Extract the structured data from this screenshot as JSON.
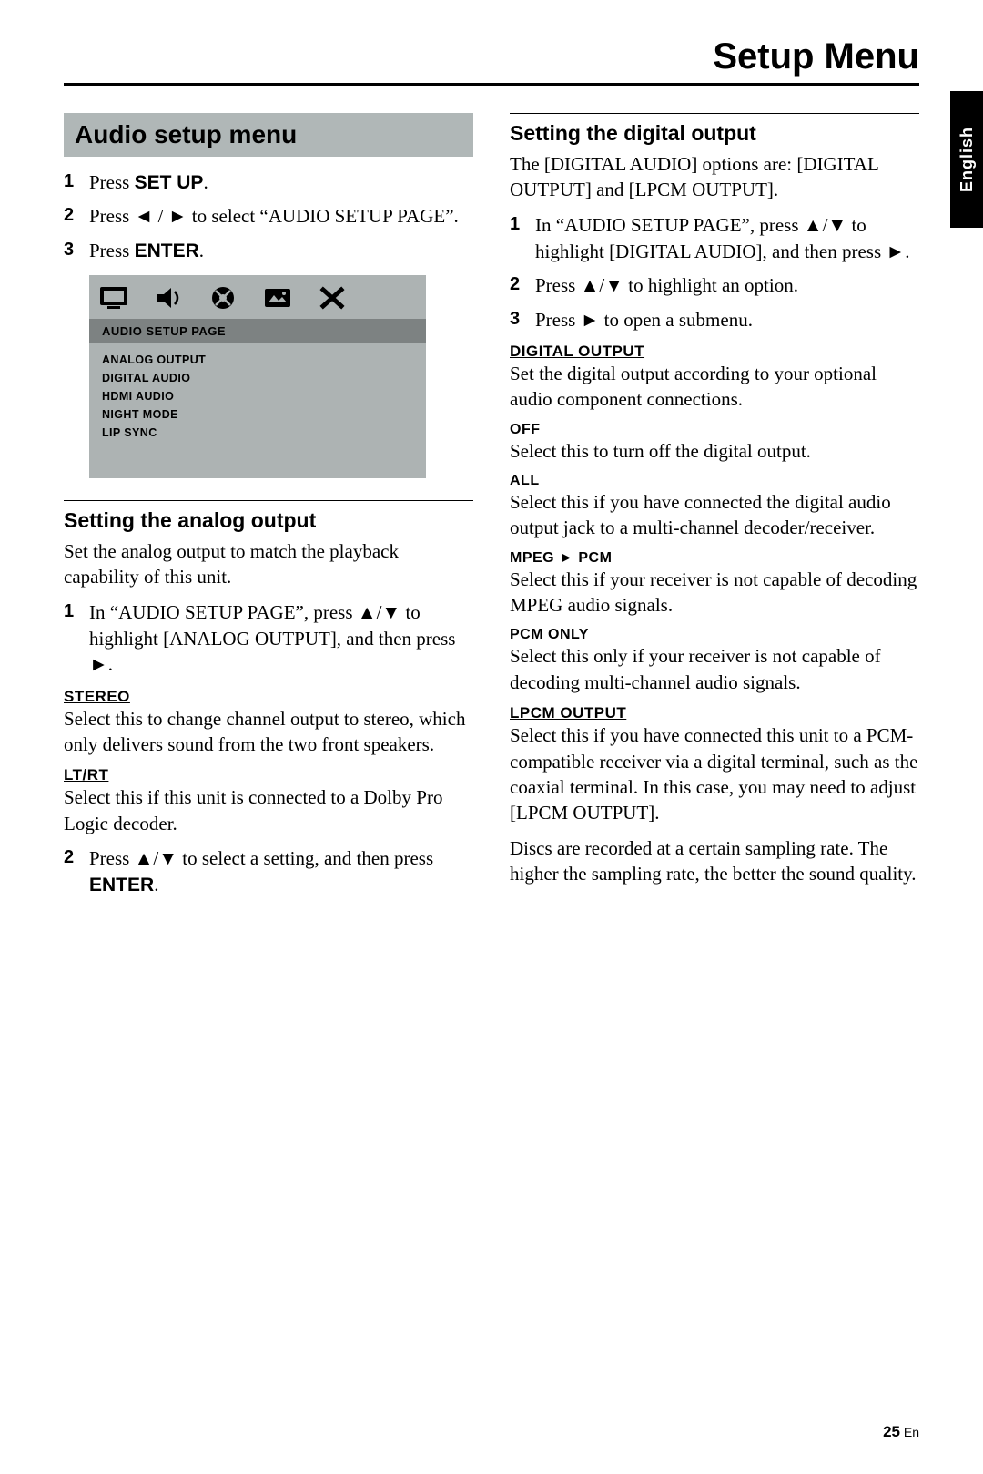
{
  "header": {
    "title": "Setup Menu"
  },
  "langTab": "English",
  "left": {
    "titleBar": "Audio setup menu",
    "steps1": {
      "s1_a": "Press ",
      "s1_b": "SET UP",
      "s1_c": ".",
      "s2_a": "Press ",
      "s2_arrL": "◄",
      "s2_slash": " / ",
      "s2_arrR": "►",
      "s2_b": " to select “AUDIO SETUP PAGE”.",
      "s3_a": "Press ",
      "s3_b": "ENTER",
      "s3_c": "."
    },
    "osd": {
      "banner": "AUDIO SETUP PAGE",
      "items": [
        "ANALOG OUTPUT",
        "DIGITAL AUDIO",
        "HDMI AUDIO",
        "NIGHT MODE",
        "LIP SYNC"
      ]
    },
    "analog": {
      "head": "Setting the analog output",
      "intro": "Set the analog output to match the playback capability of this unit.",
      "s1_a": "In “AUDIO SETUP PAGE”, press ",
      "s1_up": "▲",
      "s1_sl": "/",
      "s1_dn": "▼",
      "s1_b": " to highlight [ANALOG OUTPUT], and then press ",
      "s1_play": "►",
      "s1_c": ".",
      "stereo_h": "STEREO",
      "stereo_t": "Select this to change channel output to stereo, which only delivers sound from the two front speakers.",
      "ltrt_h": "LT/RT",
      "ltrt_t": "Select this if this unit is connected to a Dolby Pro Logic decoder.",
      "s2_a": "Press ",
      "s2_up": "▲",
      "s2_sl": "/",
      "s2_dn": "▼",
      "s2_b": " to select a setting, and then press ",
      "s2_enter": "ENTER",
      "s2_c": "."
    }
  },
  "right": {
    "digital": {
      "head": "Setting the digital output",
      "intro": "The [DIGITAL AUDIO] options are: [DIGITAL OUTPUT] and [LPCM OUTPUT].",
      "s1_a": "In “AUDIO SETUP PAGE”, press ",
      "s1_up": "▲",
      "s1_sl": "/",
      "s1_dn": "▼",
      "s1_b": " to highlight [DIGITAL AUDIO], and then press ",
      "s1_play": "►",
      "s1_c": ".",
      "s2_a": "Press ",
      "s2_up": "▲",
      "s2_sl": "/",
      "s2_dn": "▼",
      "s2_b": " to highlight an option.",
      "s3_a": "Press ",
      "s3_play": "►",
      "s3_b": " to open a submenu.",
      "do_h": "DIGITAL OUTPUT",
      "do_t": "Set the digital output according to your optional audio component connections.",
      "off_h": "OFF",
      "off_t": "Select this to turn off the digital output.",
      "all_h": "ALL",
      "all_t": "Select this if you have connected the digital audio output jack to a multi-channel decoder/receiver.",
      "mpeg_h": "MPEG ",
      "mpeg_play": "►",
      "mpeg_h2": " PCM",
      "mpeg_t": "Select this if your receiver is not capable of decoding MPEG audio signals.",
      "pcm_h": "PCM ONLY",
      "pcm_t": "Select this only if your receiver is not capable of decoding multi-channel audio signals.",
      "lpcm_h": "LPCM OUTPUT",
      "lpcm_t1": "Select this if you have connected this unit to a PCM-compatible receiver via a digital terminal, such as the coaxial terminal. In this case, you may need to adjust [LPCM OUTPUT].",
      "lpcm_t2": "Discs are recorded at a certain sampling rate. The higher the sampling rate, the better the sound quality."
    }
  },
  "footer": {
    "page": "25",
    "suffix": " En"
  }
}
